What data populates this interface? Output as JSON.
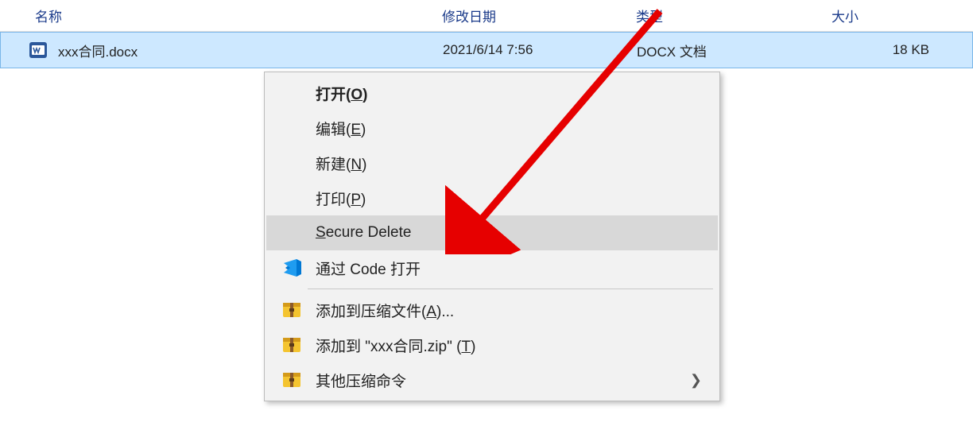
{
  "columns": {
    "name": "名称",
    "date": "修改日期",
    "type": "类型",
    "size": "大小"
  },
  "file": {
    "name": "xxx合同.docx",
    "date": "2021/6/14 7:56",
    "type": "DOCX 文档",
    "size": "18 KB"
  },
  "menu": {
    "open_pre": "打开(",
    "open_key": "O",
    "open_post": ")",
    "edit_pre": "编辑(",
    "edit_key": "E",
    "edit_post": ")",
    "new_pre": "新建(",
    "new_key": "N",
    "new_post": ")",
    "print_pre": "打印(",
    "print_key": "P",
    "print_post": ")",
    "secure_delete_pre": "",
    "secure_delete_key": "S",
    "secure_delete_post": "ecure Delete",
    "code_open": "通过 Code 打开",
    "archive_add_pre": "添加到压缩文件(",
    "archive_add_key": "A",
    "archive_add_post": ")...",
    "archive_zip_pre": "添加到 \"xxx合同.zip\" (",
    "archive_zip_key": "T",
    "archive_zip_post": ")",
    "archive_other": "其他压缩命令"
  },
  "icons": {
    "docx": "docx-icon",
    "vscode": "vscode-icon",
    "archive": "archive-icon"
  }
}
